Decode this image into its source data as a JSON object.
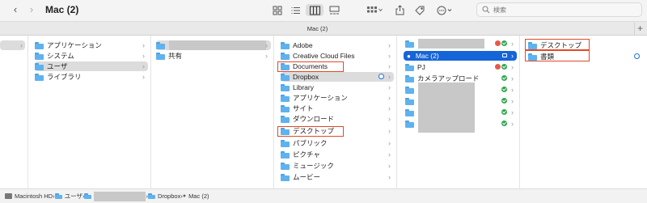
{
  "window": {
    "title": "Mac (2)",
    "tab_label": "Mac (2)",
    "tab_add": "+"
  },
  "toolbar": {
    "back": "‹",
    "forward": "›",
    "search_placeholder": "検索",
    "view_modes": [
      "icon-view",
      "list-view",
      "column-view",
      "gallery-view"
    ],
    "active_view": "column-view",
    "actions": [
      "group-by",
      "share",
      "tags",
      "more"
    ]
  },
  "columns": [
    {
      "id": "col0",
      "items": [
        {
          "label": "",
          "redacted": true,
          "selected": "gray"
        }
      ]
    },
    {
      "id": "col1",
      "items": [
        {
          "label": "アプリケーション"
        },
        {
          "label": "システム"
        },
        {
          "label": "ユーザ",
          "selected": "gray"
        },
        {
          "label": "ライブラリ"
        }
      ]
    },
    {
      "id": "col2",
      "items": [
        {
          "label": "",
          "redacted": true,
          "selected": "gray"
        },
        {
          "label": "共有"
        }
      ]
    },
    {
      "id": "col3",
      "items": [
        {
          "label": "Adobe"
        },
        {
          "label": "Creative Cloud Files"
        },
        {
          "label": "Documents",
          "highlighted": true
        },
        {
          "label": "Dropbox",
          "selected": "gray",
          "badge": "sync"
        },
        {
          "label": "Library"
        },
        {
          "label": "アプリケーション"
        },
        {
          "label": "サイト"
        },
        {
          "label": "ダウンロード"
        },
        {
          "label": "デスクトップ",
          "highlighted": true
        },
        {
          "label": "パブリック"
        },
        {
          "label": "ピクチャ"
        },
        {
          "label": "ミュージック"
        },
        {
          "label": "ムービー"
        }
      ]
    },
    {
      "id": "col4",
      "items": [
        {
          "label": "",
          "redacted": true,
          "badge": "red+green"
        },
        {
          "label": "Mac (2)",
          "selected": "blue"
        },
        {
          "label": "PJ",
          "badge": "red+green"
        },
        {
          "label": "カメラアップロード",
          "badge": "green"
        },
        {
          "label": "",
          "redacted": true,
          "badge": "green"
        },
        {
          "label": "",
          "redacted": true,
          "badge": "green"
        },
        {
          "label": "",
          "redacted": true,
          "badge": "green"
        },
        {
          "label": "",
          "redacted": true,
          "badge": "green"
        }
      ]
    },
    {
      "id": "col5",
      "items": [
        {
          "label": "デスクトップ",
          "highlighted": true
        },
        {
          "label": "書類",
          "highlighted": true,
          "badge": "sync"
        }
      ]
    }
  ],
  "pathbar": {
    "crumbs": [
      "Macintosh HD",
      "ユーザ",
      "",
      "Dropbox",
      "Mac (2)"
    ]
  }
}
